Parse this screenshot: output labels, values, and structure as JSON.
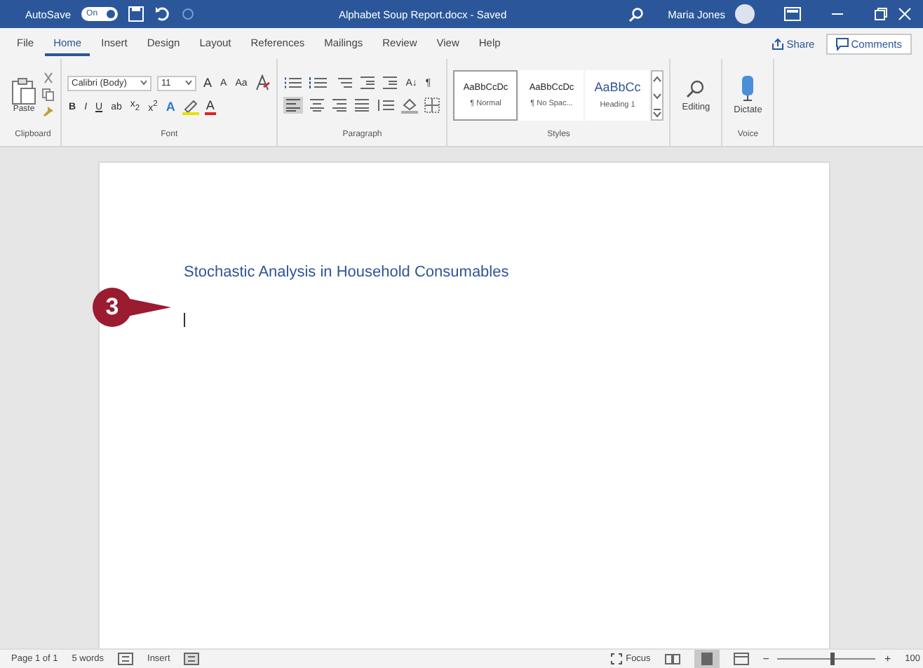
{
  "title_bar": {
    "autosave_label": "AutoSave",
    "autosave_toggle": {
      "label": "On",
      "on": true
    },
    "title": "Alphabet Soup Report.docx - Saved",
    "user": "Maria Jones"
  },
  "tabs": [
    {
      "label": "File",
      "selected": false
    },
    {
      "label": "Home",
      "selected": true
    },
    {
      "label": "Insert",
      "selected": false
    },
    {
      "label": "Design",
      "selected": false
    },
    {
      "label": "Layout",
      "selected": false
    },
    {
      "label": "References",
      "selected": false
    },
    {
      "label": "Mailings",
      "selected": false
    },
    {
      "label": "Review",
      "selected": false
    },
    {
      "label": "View",
      "selected": false
    },
    {
      "label": "Help",
      "selected": false
    }
  ],
  "share": "Share",
  "comments": "Comments",
  "ribbon": {
    "clipboard": {
      "paste": "Paste",
      "label": "Clipboard"
    },
    "font": {
      "font_name": "Calibri (Body)",
      "font_size": "11",
      "grow": "A",
      "shrink": "A",
      "case": "Aa",
      "format_buttons": [
        "B",
        "I",
        "U",
        "ab",
        "x$_{2}$",
        "x$^{2}$"
      ],
      "effects": "A",
      "font_color": "A",
      "label": "Font"
    },
    "paragraph": {
      "sort": "A↓",
      "pilcrow": "¶",
      "label": "Paragraph"
    },
    "styles": {
      "items": [
        {
          "preview": "AaBbCcDc",
          "name": "¶ Normal",
          "selected": true,
          "kind": "body"
        },
        {
          "preview": "AaBbCcDc",
          "name": "¶ No Spac...",
          "selected": false,
          "kind": "body"
        },
        {
          "preview": "AaBbCc",
          "name": "Heading 1",
          "selected": false,
          "kind": "heading"
        }
      ],
      "label": "Styles"
    },
    "editing": "Editing",
    "dictate": "Dictate",
    "voice": "Voice"
  },
  "document": {
    "heading": "Stochastic Analysis in Household Consumables",
    "callout": "3"
  },
  "status_bar": {
    "page": "Page 1 of 1",
    "words": "5 words",
    "mode": "Insert",
    "focus": "Focus",
    "zoom": {
      "level": 0.55,
      "label": "100",
      "zoom_out": "−",
      "zoom_in": "+"
    }
  }
}
